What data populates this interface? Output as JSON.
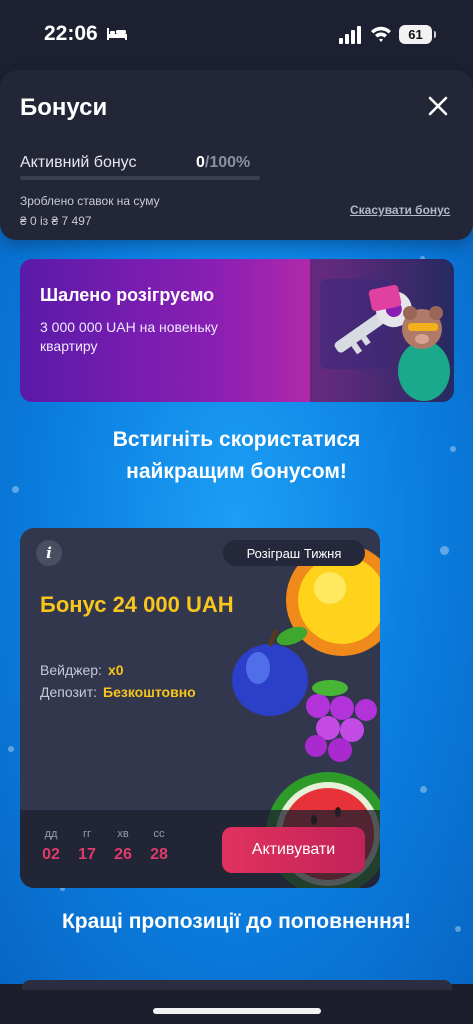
{
  "status_bar": {
    "time": "22:06",
    "battery": "61",
    "icons": [
      "bed-icon",
      "signal-icon",
      "wifi-icon",
      "battery-icon"
    ]
  },
  "bonus_sheet": {
    "title": "Бонуси",
    "active_bonus_label": "Активний бонус",
    "progress_current": "0",
    "progress_max": "/100%",
    "progress_fraction": 0,
    "bets_label": "Зроблено ставок на суму",
    "bets_amount": "₴ 0 із ₴ 7 497",
    "cancel_label": "Скасувати бонус"
  },
  "promo_banner": {
    "title": "Шалено розігруємо",
    "text": "3 000 000 UAH на новеньку квартиру"
  },
  "headline": {
    "line1": "Встигніть скористатися",
    "line2": "найкращим бонусом!"
  },
  "bonus_card": {
    "tag": "Розіграш Тижня",
    "title": "Бонус 24 000 UAH",
    "wager_label": "Вейджер:",
    "wager_value": "x0",
    "deposit_label": "Депозит:",
    "deposit_value": "Безкоштовно",
    "timer": [
      {
        "label": "дд",
        "value": "02"
      },
      {
        "label": "гг",
        "value": "17"
      },
      {
        "label": "хв",
        "value": "26"
      },
      {
        "label": "сс",
        "value": "28"
      }
    ],
    "activate_label": "Активувати"
  },
  "subhead": "Кращі пропозиції до поповнення!",
  "colors": {
    "accent": "#e0325e",
    "gold": "#f7c51c",
    "sheet_bg": "#232636",
    "card_bg": "#33374d",
    "page_blue": "#0b7ee0"
  }
}
